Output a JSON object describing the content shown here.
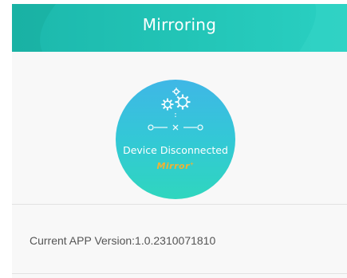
{
  "header": {
    "title": "Mirroring",
    "background_color": "#22c4b6"
  },
  "status": {
    "label": "Device Disconnected",
    "brand_name": "Mirror",
    "brand_mark": "+",
    "icons": [
      "gears-icon",
      "disconnected-link-icon"
    ],
    "circle_gradient": [
      "#3fb7e6",
      "#2fd6be"
    ],
    "brand_color": "#f2b233"
  },
  "info": {
    "version_text": "Current APP Version:1.0.2310071810"
  }
}
